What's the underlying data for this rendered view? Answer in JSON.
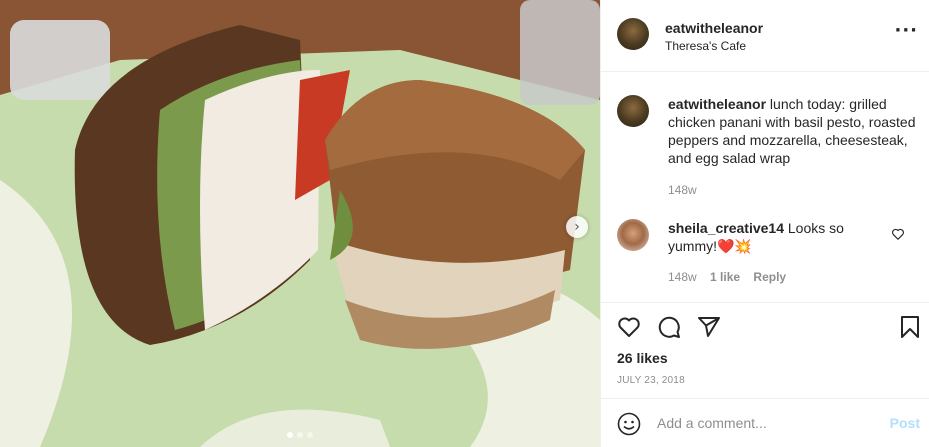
{
  "post": {
    "username": "eatwitheleanor",
    "location": "Theresa's Cafe",
    "more_icon": "more-horizontal-icon"
  },
  "caption": {
    "username": "eatwitheleanor",
    "text": "lunch today: grilled chicken panani with basil pesto, roasted peppers and mozzarella, cheesesteak, and egg salad wrap",
    "time": "148w"
  },
  "comment": {
    "username": "sheila_creative14",
    "text": "Looks so yummy!",
    "emoji": "❤️💥",
    "time": "148w",
    "likes": "1 like",
    "reply": "Reply"
  },
  "actions": {
    "likes": "26 likes",
    "date": "July 23, 2018",
    "icons": [
      "heart-icon",
      "comment-icon",
      "share-icon",
      "bookmark-icon"
    ]
  },
  "add_comment": {
    "placeholder": "Add a comment...",
    "post_label": "Post",
    "icon": "smile-icon"
  },
  "carousel": {
    "next": "›",
    "slides": 3,
    "current": 1
  },
  "colors": {
    "post_button": "#b2dffc",
    "border": "#efefef",
    "text": "#262626",
    "muted": "#8e8e8e"
  }
}
